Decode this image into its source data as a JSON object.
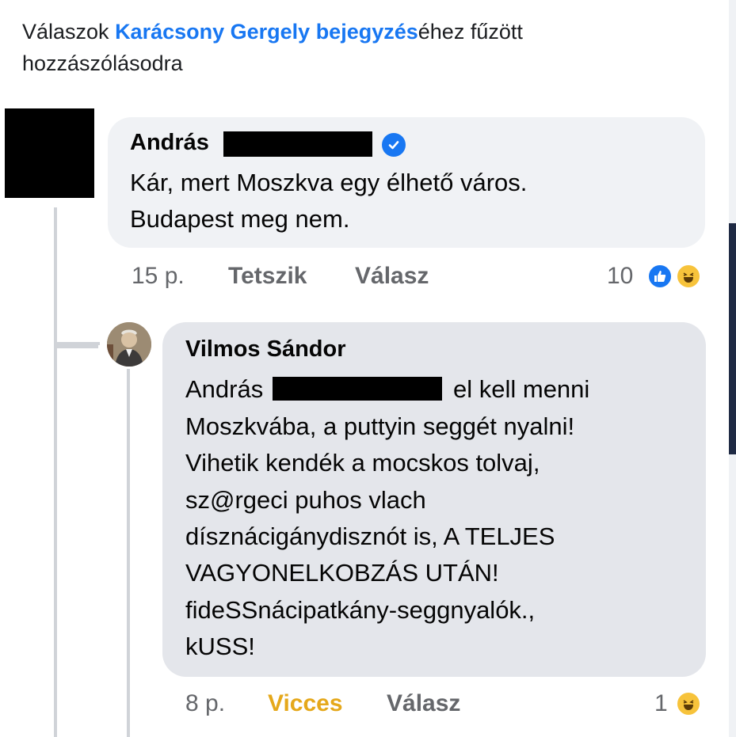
{
  "header": {
    "prefix": "Válaszok ",
    "link": "Karácsony Gergely bejegyzés",
    "suffix": "éhez fűzött",
    "line2": "hozzászólásodra"
  },
  "comment1": {
    "author": "András",
    "line1": "Kár, mert Moszkva egy élhető város.",
    "line2": "Budapest meg nem.",
    "time": "15 p.",
    "like_label": "Tetszik",
    "reply_label": "Válasz",
    "reaction_count": "10",
    "reactions": [
      "like-icon",
      "haha-icon"
    ]
  },
  "comment2": {
    "author": "Vilmos Sándor",
    "line1_start": "András",
    "line1_end": "el kell menni",
    "lines": [
      "Moszkvába, a puttyin seggét nyalni!",
      "Vihetik kendék a mocskos tolvaj,",
      "sz@rgeci puhos vlach",
      "dísznácigánydisznót is, A TELJES",
      "VAGYONELKOBZÁS UTÁN!",
      "fideSSnácipatkány-seggnyalók.,",
      "kUSS!"
    ],
    "time": "8 p.",
    "reaction_label": "Vicces",
    "reply_label": "Válasz",
    "reaction_count": "1",
    "reactions": [
      "haha-icon"
    ]
  },
  "colors": {
    "link": "#1877f2",
    "vicces": "#e5a81b",
    "bubble": "#f0f2f5",
    "meta": "#65676b"
  }
}
